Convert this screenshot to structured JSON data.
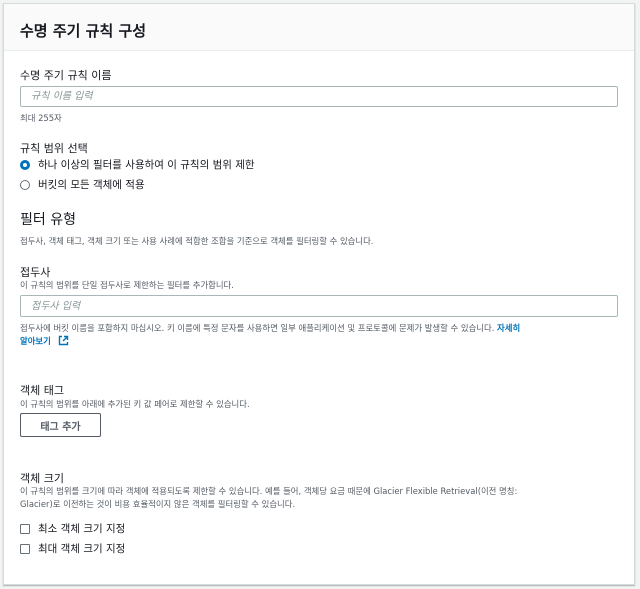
{
  "panel": {
    "title": "수명 주기 규칙 구성"
  },
  "rule_name": {
    "label": "수명 주기 규칙 이름",
    "placeholder": "규칙 이름 입력",
    "constraint": "최대 255자"
  },
  "scope": {
    "label": "규칙 범위 선택",
    "options": [
      {
        "label": "하나 이상의 필터를 사용하여 이 규칙의 범위 제한",
        "selected": true
      },
      {
        "label": "버킷의 모든 객체에 적용",
        "selected": false
      }
    ]
  },
  "filter_type": {
    "title": "필터 유형",
    "description": "접두사, 객체 태그, 객체 크기 또는 사용 사례에 적합한 조합을 기준으로 객체를 필터링할 수 있습니다."
  },
  "prefix": {
    "label": "접두사",
    "description": "이 규칙의 범위를 단일 접두사로 제한하는 필터를 추가합니다.",
    "placeholder": "접두사 입력",
    "warning": "접두사에 버킷 이름을 포함하지 마십시오. 키 이름에 특정 문자를 사용하면 일부 애플리케이션 및 프로토콜에 문제가 발생할 수 있습니다.",
    "learn_more_1": "자세히",
    "learn_more_2": "알아보기",
    "learn_more_icon": "external-link-icon"
  },
  "object_tags": {
    "label": "객체 태그",
    "description": "이 규칙의 범위를 아래에 추가된 키 값 페어로 제한할 수 있습니다.",
    "add_button": "태그 추가"
  },
  "object_size": {
    "label": "객체 크기",
    "description_1": "이 규칙의 범위를 크기에 따라 객체에 적용되도록 제한할 수 있습니다. 예를 들어, 객체당 요금 때문에 Glacier Flexible Retrieval(이전 명칭:",
    "description_2": "Glacier)로 이전하는 것이 비용 효율적이지 않은 객체를 필터링할 수 있습니다.",
    "min_label": "최소 객체 크기 지정",
    "max_label": "최대 객체 크기 지정",
    "min_checked": false,
    "max_checked": false
  },
  "colors": {
    "accent": "#0073bb",
    "text": "#16191f",
    "muted": "#545b64",
    "border": "#aab7b8"
  }
}
